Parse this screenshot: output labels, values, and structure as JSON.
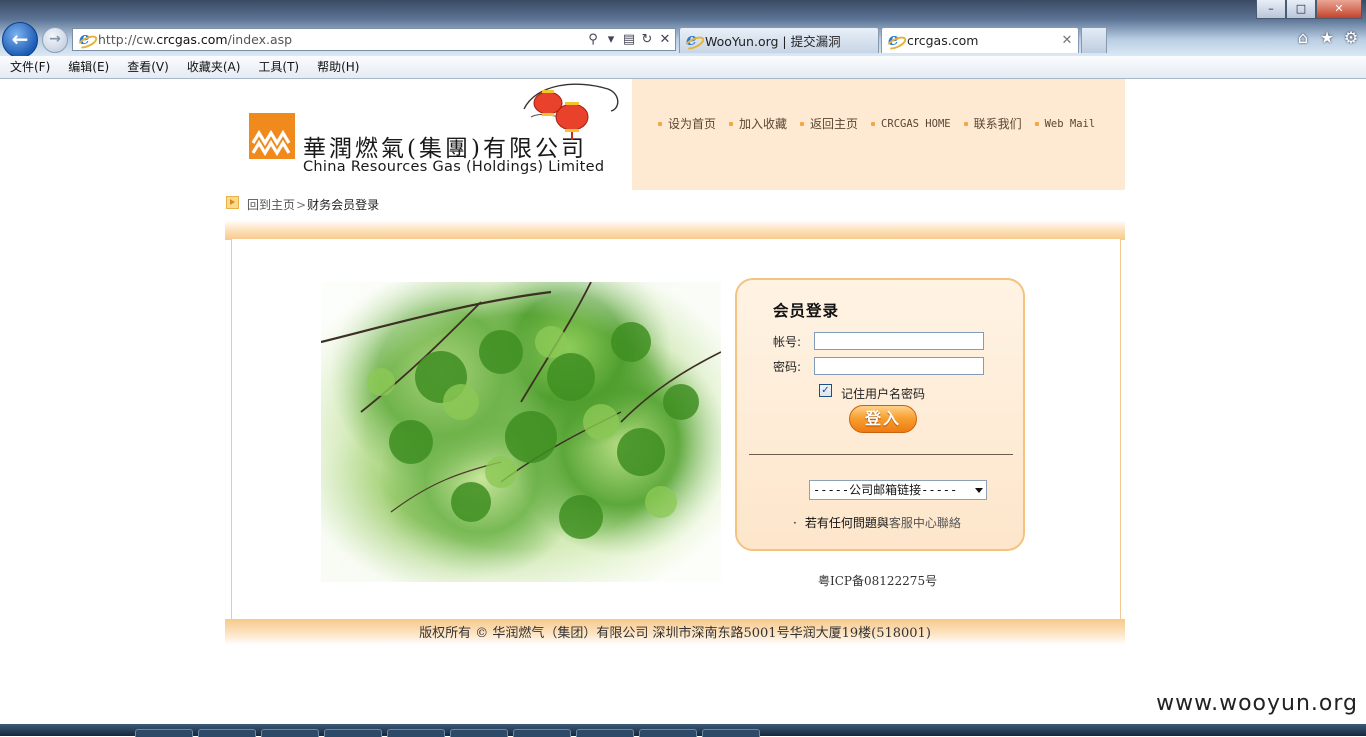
{
  "browser": {
    "address": "http://cw.crcgas.com/index.asp",
    "address_prefix": "http://cw.",
    "address_domain": "crcgas.com",
    "address_path": "/index.asp",
    "tabs": [
      {
        "label": "WooYun.org | 提交漏洞",
        "active": false
      },
      {
        "label": "crcgas.com",
        "active": true
      }
    ],
    "menu": [
      "文件(F)",
      "编辑(E)",
      "查看(V)",
      "收藏夹(A)",
      "工具(T)",
      "帮助(H)"
    ],
    "window_controls": {
      "minimize": "–",
      "maximize": "□",
      "close": "✕"
    }
  },
  "header": {
    "logo_cn": "華潤燃氣(集團)有限公司",
    "logo_en": "China Resources Gas (Holdings) Limited",
    "links": [
      "设为首页",
      "加入收藏",
      "返回主页",
      "CRCGAS HOME",
      "联系我们",
      "Web Mail"
    ]
  },
  "breadcrumb": {
    "home": "回到主页",
    "separator": ">",
    "current": "财务会员登录"
  },
  "login": {
    "title": "会员登录",
    "account_label": "帐号:",
    "password_label": "密码:",
    "account_value": "",
    "password_value": "",
    "remember_label": "记住用户名密码",
    "remember_checked": "✓",
    "submit_label": "登入",
    "mail_select_value": "-----公司邮箱链接-----",
    "help_bullet": "·",
    "help_prefix": "若有任何問題與",
    "help_link": "客服中心聯絡"
  },
  "icp": "粤ICP备08122275号",
  "footer": "版权所有 © 华润燃气（集团）有限公司 深圳市深南东路5001号华润大厦19楼(518001)",
  "watermark": "www.wooyun.org",
  "colors": {
    "accent_orange": "#f08a1c",
    "header_bg": "#feead2",
    "login_border": "#f5c27f"
  }
}
